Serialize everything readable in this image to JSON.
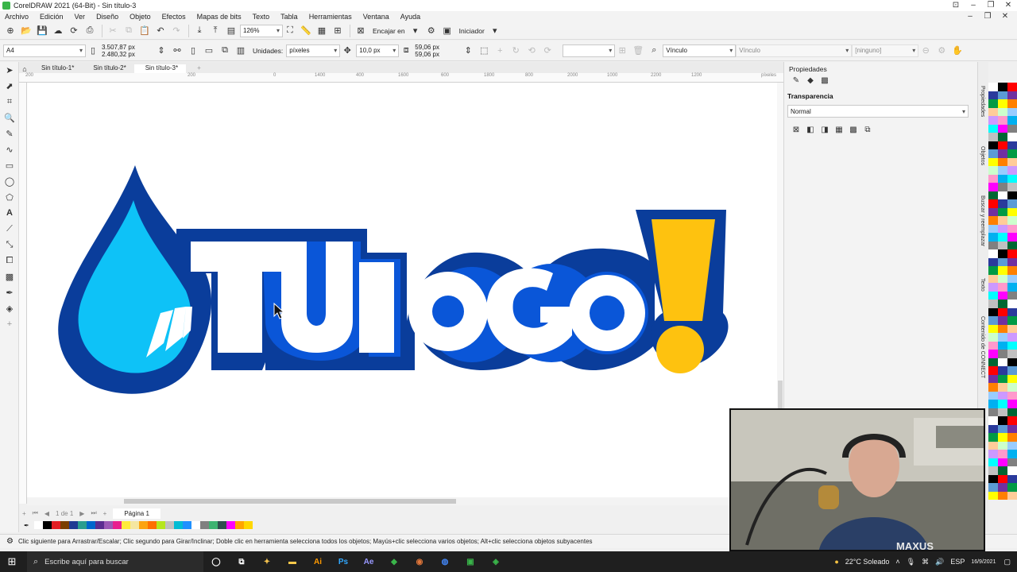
{
  "window": {
    "title": "CorelDRAW 2021 (64-Bit) - Sin título-3"
  },
  "menu": [
    "Archivo",
    "Edición",
    "Ver",
    "Diseño",
    "Objeto",
    "Efectos",
    "Mapas de bits",
    "Texto",
    "Tabla",
    "Herramientas",
    "Ventana",
    "Ayuda"
  ],
  "toolbar1": {
    "zoom": "126%",
    "snap_label": "Encajar en",
    "launcher_label": "Iniciador"
  },
  "toolbar2": {
    "page_size": "A4",
    "width": "3.507,87 px",
    "height": "2.480,32 px",
    "units_label": "Unidades:",
    "units": "píxeles",
    "nudge": "10,0 px",
    "dup_x": "59,06 px",
    "dup_y": "59,06 px",
    "link1": "Vínculo",
    "link2": "Vínculo",
    "none": "[ninguno]"
  },
  "tabs": [
    "Sin título-1*",
    "Sin título-2*",
    "Sin título-3*"
  ],
  "ruler": [
    "200",
    "0",
    "200",
    "400",
    "600",
    "800",
    "1000",
    "1200",
    "1400",
    "1600",
    "1800",
    "2000",
    "2200",
    "píxeles"
  ],
  "pagenav": {
    "counter": "1 de 1",
    "page_tab": "Página 1"
  },
  "status": {
    "message": "Clic siguiente para Arrastrar/Escalar; Clic segundo para Girar/Inclinar; Doble clic en herramienta selecciona todos los objetos; Mayús+clic selecciona varios objetos; Alt+clic selecciona objetos subyacentes"
  },
  "properties": {
    "header": "Propiedades",
    "section": "Transparencia",
    "mode": "Normal"
  },
  "sidetabs": [
    "Propiedades",
    "Objetos",
    "Buscar y reemplazar",
    "Texto",
    "Contenido de CONNECT"
  ],
  "logo": {
    "text": "TUloGO",
    "colors": {
      "dark_blue": "#0a3d9b",
      "mid_blue": "#0a56d8",
      "light_blue": "#0ec2f7",
      "yellow": "#fec20f"
    }
  },
  "webcam": {
    "watermark": "MAXUS"
  },
  "taskbar": {
    "search_placeholder": "Escribe aquí para buscar",
    "weather": "22°C  Soleado",
    "lang": "ESP",
    "date": "16/9/2021"
  },
  "palette_colors": [
    "#ffffff",
    "#000000",
    "#ff0000",
    "#2a3a9c",
    "#5b9bd5",
    "#7030a0",
    "#009a44",
    "#ffff00",
    "#ff8000",
    "#ffcc99",
    "#ccffcc",
    "#99ccff",
    "#cc99ff",
    "#ff99cc",
    "#00b0f0",
    "#00ffff",
    "#ff00ff",
    "#808080",
    "#c0c0c0",
    "#006633"
  ],
  "doc_palette": [
    "#ffffff",
    "#000000",
    "#e31e24",
    "#7b3f00",
    "#1f3a93",
    "#2a9d8f",
    "#0066cc",
    "#5b2d90",
    "#9b59b6",
    "#e91e8f",
    "#ffeb3b",
    "#f5e6a0",
    "#fca311",
    "#ff6f00",
    "#b5e61d",
    "#c0c0c0",
    "#00bcd4",
    "#1e90ff",
    "#ffffff",
    "#808080",
    "#3cb371",
    "#2f4f4f",
    "#ff00ff",
    "#ffa500",
    "#ffd700"
  ]
}
